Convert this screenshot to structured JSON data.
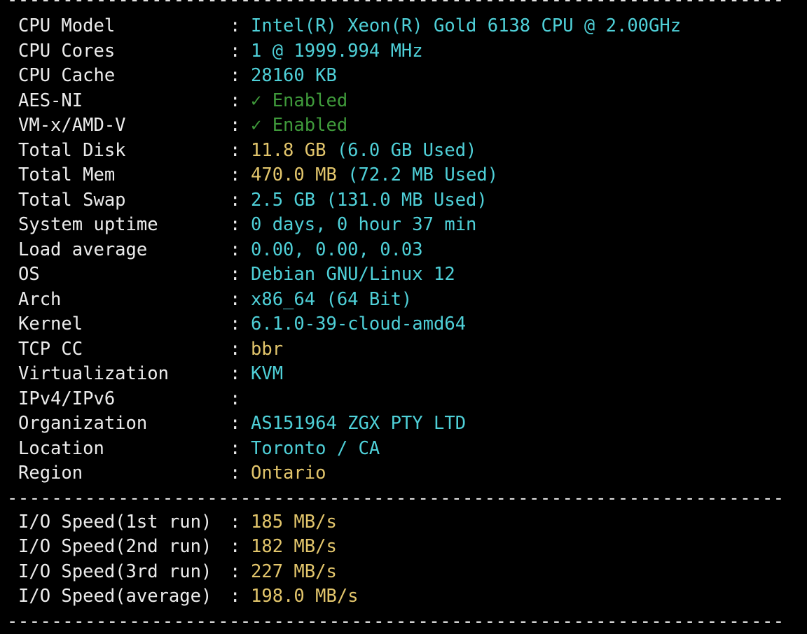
{
  "separator": "----------------------------------------------------------------------",
  "sysinfo": [
    {
      "label": "CPU Model",
      "value": "Intel(R) Xeon(R) Gold 6138 CPU @ 2.00GHz",
      "color": "cyan"
    },
    {
      "label": "CPU Cores",
      "value": "1 @ 1999.994 MHz",
      "color": "cyan"
    },
    {
      "label": "CPU Cache",
      "value": "28160 KB",
      "color": "cyan"
    },
    {
      "label": "AES-NI",
      "value": "✓ Enabled",
      "color": "green"
    },
    {
      "label": "VM-x/AMD-V",
      "value": "✓ Enabled",
      "color": "green"
    },
    {
      "label": "Total Disk",
      "value": "11.8 GB",
      "value_extra": "(6.0 GB Used)",
      "color": "yellow",
      "extra_color": "cyan"
    },
    {
      "label": "Total Mem",
      "value": "470.0 MB",
      "value_extra": "(72.2 MB Used)",
      "color": "yellow",
      "extra_color": "cyan"
    },
    {
      "label": "Total Swap",
      "value": "2.5 GB (131.0 MB Used)",
      "color": "cyan"
    },
    {
      "label": "System uptime",
      "value": "0 days, 0 hour 37 min",
      "color": "cyan"
    },
    {
      "label": "Load average",
      "value": "0.00, 0.00, 0.03",
      "color": "cyan"
    },
    {
      "label": "OS",
      "value": "Debian GNU/Linux 12",
      "color": "cyan"
    },
    {
      "label": "Arch",
      "value": "x86_64 (64 Bit)",
      "color": "cyan"
    },
    {
      "label": "Kernel",
      "value": "6.1.0-39-cloud-amd64",
      "color": "cyan"
    },
    {
      "label": "TCP CC",
      "value": "bbr",
      "color": "yellow"
    },
    {
      "label": "Virtualization",
      "value": "KVM",
      "color": "cyan"
    },
    {
      "label": "IPv4/IPv6",
      "value": "",
      "color": "cyan"
    },
    {
      "label": "Organization",
      "value": "AS151964 ZGX PTY LTD",
      "color": "cyan"
    },
    {
      "label": "Location",
      "value": "Toronto / CA",
      "color": "cyan"
    },
    {
      "label": "Region",
      "value": "Ontario",
      "color": "yellow"
    }
  ],
  "io": [
    {
      "label": "I/O Speed(1st run)",
      "value": "185 MB/s",
      "color": "yellow"
    },
    {
      "label": "I/O Speed(2nd run)",
      "value": "182 MB/s",
      "color": "yellow"
    },
    {
      "label": "I/O Speed(3rd run)",
      "value": "227 MB/s",
      "color": "yellow"
    },
    {
      "label": "I/O Speed(average)",
      "value": "198.0 MB/s",
      "color": "yellow"
    }
  ],
  "colors": {
    "cyan": "#4fd0d8",
    "green": "#3f9a3b",
    "yellow": "#e3c66c",
    "background": "#000000",
    "text": "#ececec"
  },
  "colon": ":"
}
